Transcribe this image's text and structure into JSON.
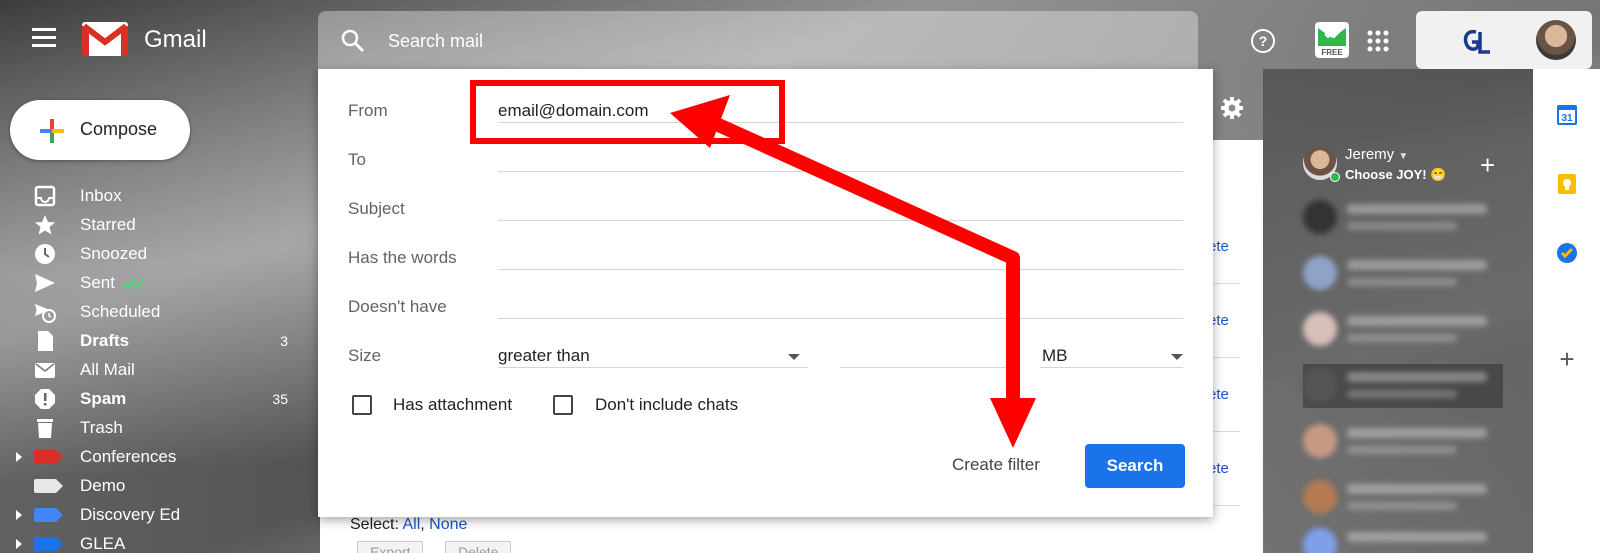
{
  "app": {
    "brand": "Gmail"
  },
  "search": {
    "placeholder": "Search mail"
  },
  "compose": {
    "label": "Compose"
  },
  "sidebar": {
    "items": [
      {
        "label": "Inbox",
        "count": "",
        "bold": false
      },
      {
        "label": "Starred",
        "count": "",
        "bold": false
      },
      {
        "label": "Snoozed",
        "count": "",
        "bold": false
      },
      {
        "label": "Sent",
        "count": "",
        "bold": false
      },
      {
        "label": "Scheduled",
        "count": "",
        "bold": false
      },
      {
        "label": "Drafts",
        "count": "3",
        "bold": true
      },
      {
        "label": "All Mail",
        "count": "",
        "bold": false
      },
      {
        "label": "Spam",
        "count": "35",
        "bold": true
      },
      {
        "label": "Trash",
        "count": "",
        "bold": false
      },
      {
        "label": "Conferences",
        "count": "",
        "bold": false,
        "color": "#d93025"
      },
      {
        "label": "Demo",
        "count": "",
        "bold": false,
        "color": "#e8e8e8"
      },
      {
        "label": "Discovery Ed",
        "count": "",
        "bold": false,
        "color": "#4285f4"
      },
      {
        "label": "GLEA",
        "count": "",
        "bold": false,
        "color": "#1a73e8"
      }
    ]
  },
  "filter_dialog": {
    "from_label": "From",
    "from_value": "email@domain.com",
    "to_label": "To",
    "subject_label": "Subject",
    "has_words_label": "Has the words",
    "doesnt_have_label": "Doesn't have",
    "size_label": "Size",
    "size_operator": "greater than",
    "size_unit": "MB",
    "has_attachment_label": "Has attachment",
    "dont_include_chats_label": "Don't include chats",
    "create_filter_label": "Create filter",
    "search_button_label": "Search"
  },
  "list": {
    "row_link": "ete",
    "select_prefix": "Select:",
    "select_all": "All",
    "select_sep": ",",
    "select_none": "None",
    "export_label": "Export",
    "delete_label": "Delete"
  },
  "chat": {
    "name": "Jeremy",
    "status": "Choose JOY! 😁"
  },
  "extension": {
    "badge": "FREE"
  },
  "colors": {
    "accent": "#1a73e8",
    "annotation": "#ff0000"
  }
}
